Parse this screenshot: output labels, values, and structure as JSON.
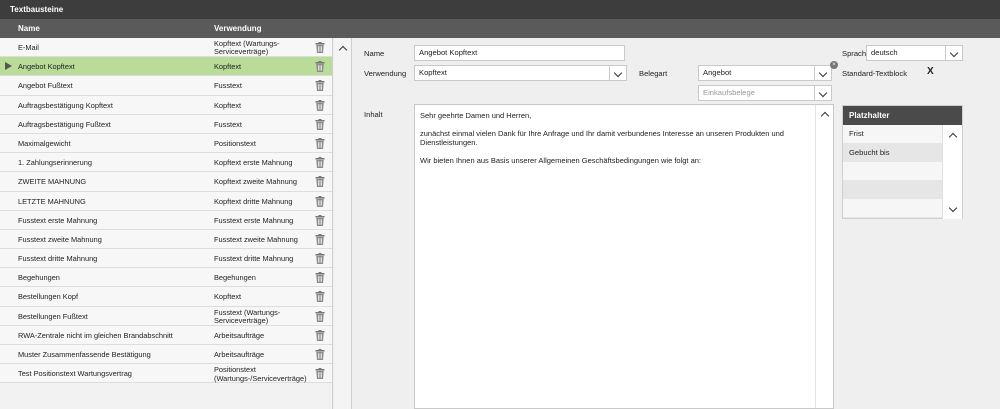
{
  "window": {
    "title": "Textbausteine"
  },
  "columns": {
    "name": "Name",
    "usage": "Verwendung"
  },
  "rows": [
    {
      "name": "E-Mail",
      "usage": "Kopftext (Wartungs-Serviceverträge)"
    },
    {
      "name": "Angebot Kopftext",
      "usage": "Kopftext",
      "selected": true
    },
    {
      "name": "Angebot Fußtext",
      "usage": "Fusstext"
    },
    {
      "name": "Auftragsbestätigung Kopftext",
      "usage": "Kopftext"
    },
    {
      "name": "Auftragsbestätigung Fußtext",
      "usage": "Fusstext"
    },
    {
      "name": "Maximalgewicht",
      "usage": "Positionstext"
    },
    {
      "name": "1. Zahlungserinnerung",
      "usage": "Kopftext erste Mahnung"
    },
    {
      "name": "ZWEITE MAHNUNG",
      "usage": "Kopftext zweite Mahnung"
    },
    {
      "name": "LETZTE MAHNUNG",
      "usage": "Kopftext dritte Mahnung"
    },
    {
      "name": "Fusstext erste Mahnung",
      "usage": "Fusstext erste Mahnung"
    },
    {
      "name": "Fusstext zweite Mahnung",
      "usage": "Fusstext zweite Mahnung"
    },
    {
      "name": "Fusstext dritte Mahnung",
      "usage": "Fusstext dritte Mahnung"
    },
    {
      "name": "Begehungen",
      "usage": "Begehungen"
    },
    {
      "name": "Bestellungen Kopf",
      "usage": "Kopftext"
    },
    {
      "name": "Bestellungen Fußtext",
      "usage": "Fusstext (Wartungs-Serviceverträge)"
    },
    {
      "name": "RWA-Zentrale nicht im gleichen Brandabschnitt",
      "usage": "Arbeitsaufträge"
    },
    {
      "name": "Muster Zusammenfassende Bestätigung",
      "usage": "Arbeitsaufträge"
    },
    {
      "name": "Test Positionstext Wartungsvertrag",
      "usage": "Positionstext (Wartungs-/Serviceverträge)"
    }
  ],
  "detail": {
    "name_label": "Name",
    "name_value": "Angebot Kopftext",
    "usage_label": "Verwendung",
    "usage_value": "Kopftext",
    "doctype_label": "Belegart",
    "doctype_value": "Angebot",
    "doctype_placeholder": "Einkaufsbelege",
    "language_label": "Sprache",
    "language_value": "deutsch",
    "standard_label": "Standard-Textblock",
    "standard_value": "X",
    "content_label": "Inhalt",
    "content_paragraphs": [
      "Sehr geehrte Damen und Herren,",
      "zunächst einmal vielen Dank für Ihre Anfrage und Ihr damit verbundenes Interesse an unseren Produkten und Dienstleistungen.",
      "Wir bieten Ihnen aus Basis unserer Allgemeinen Geschäftsbedingungen wie folgt an:"
    ]
  },
  "placeholders": {
    "title": "Platzhalter",
    "items": [
      "Frist",
      "Gebucht bis",
      "",
      "",
      ""
    ]
  },
  "colors": {
    "selected_row": "#b9dc99",
    "titlebar": "#3d3d3d",
    "header": "#5a5a5a"
  }
}
